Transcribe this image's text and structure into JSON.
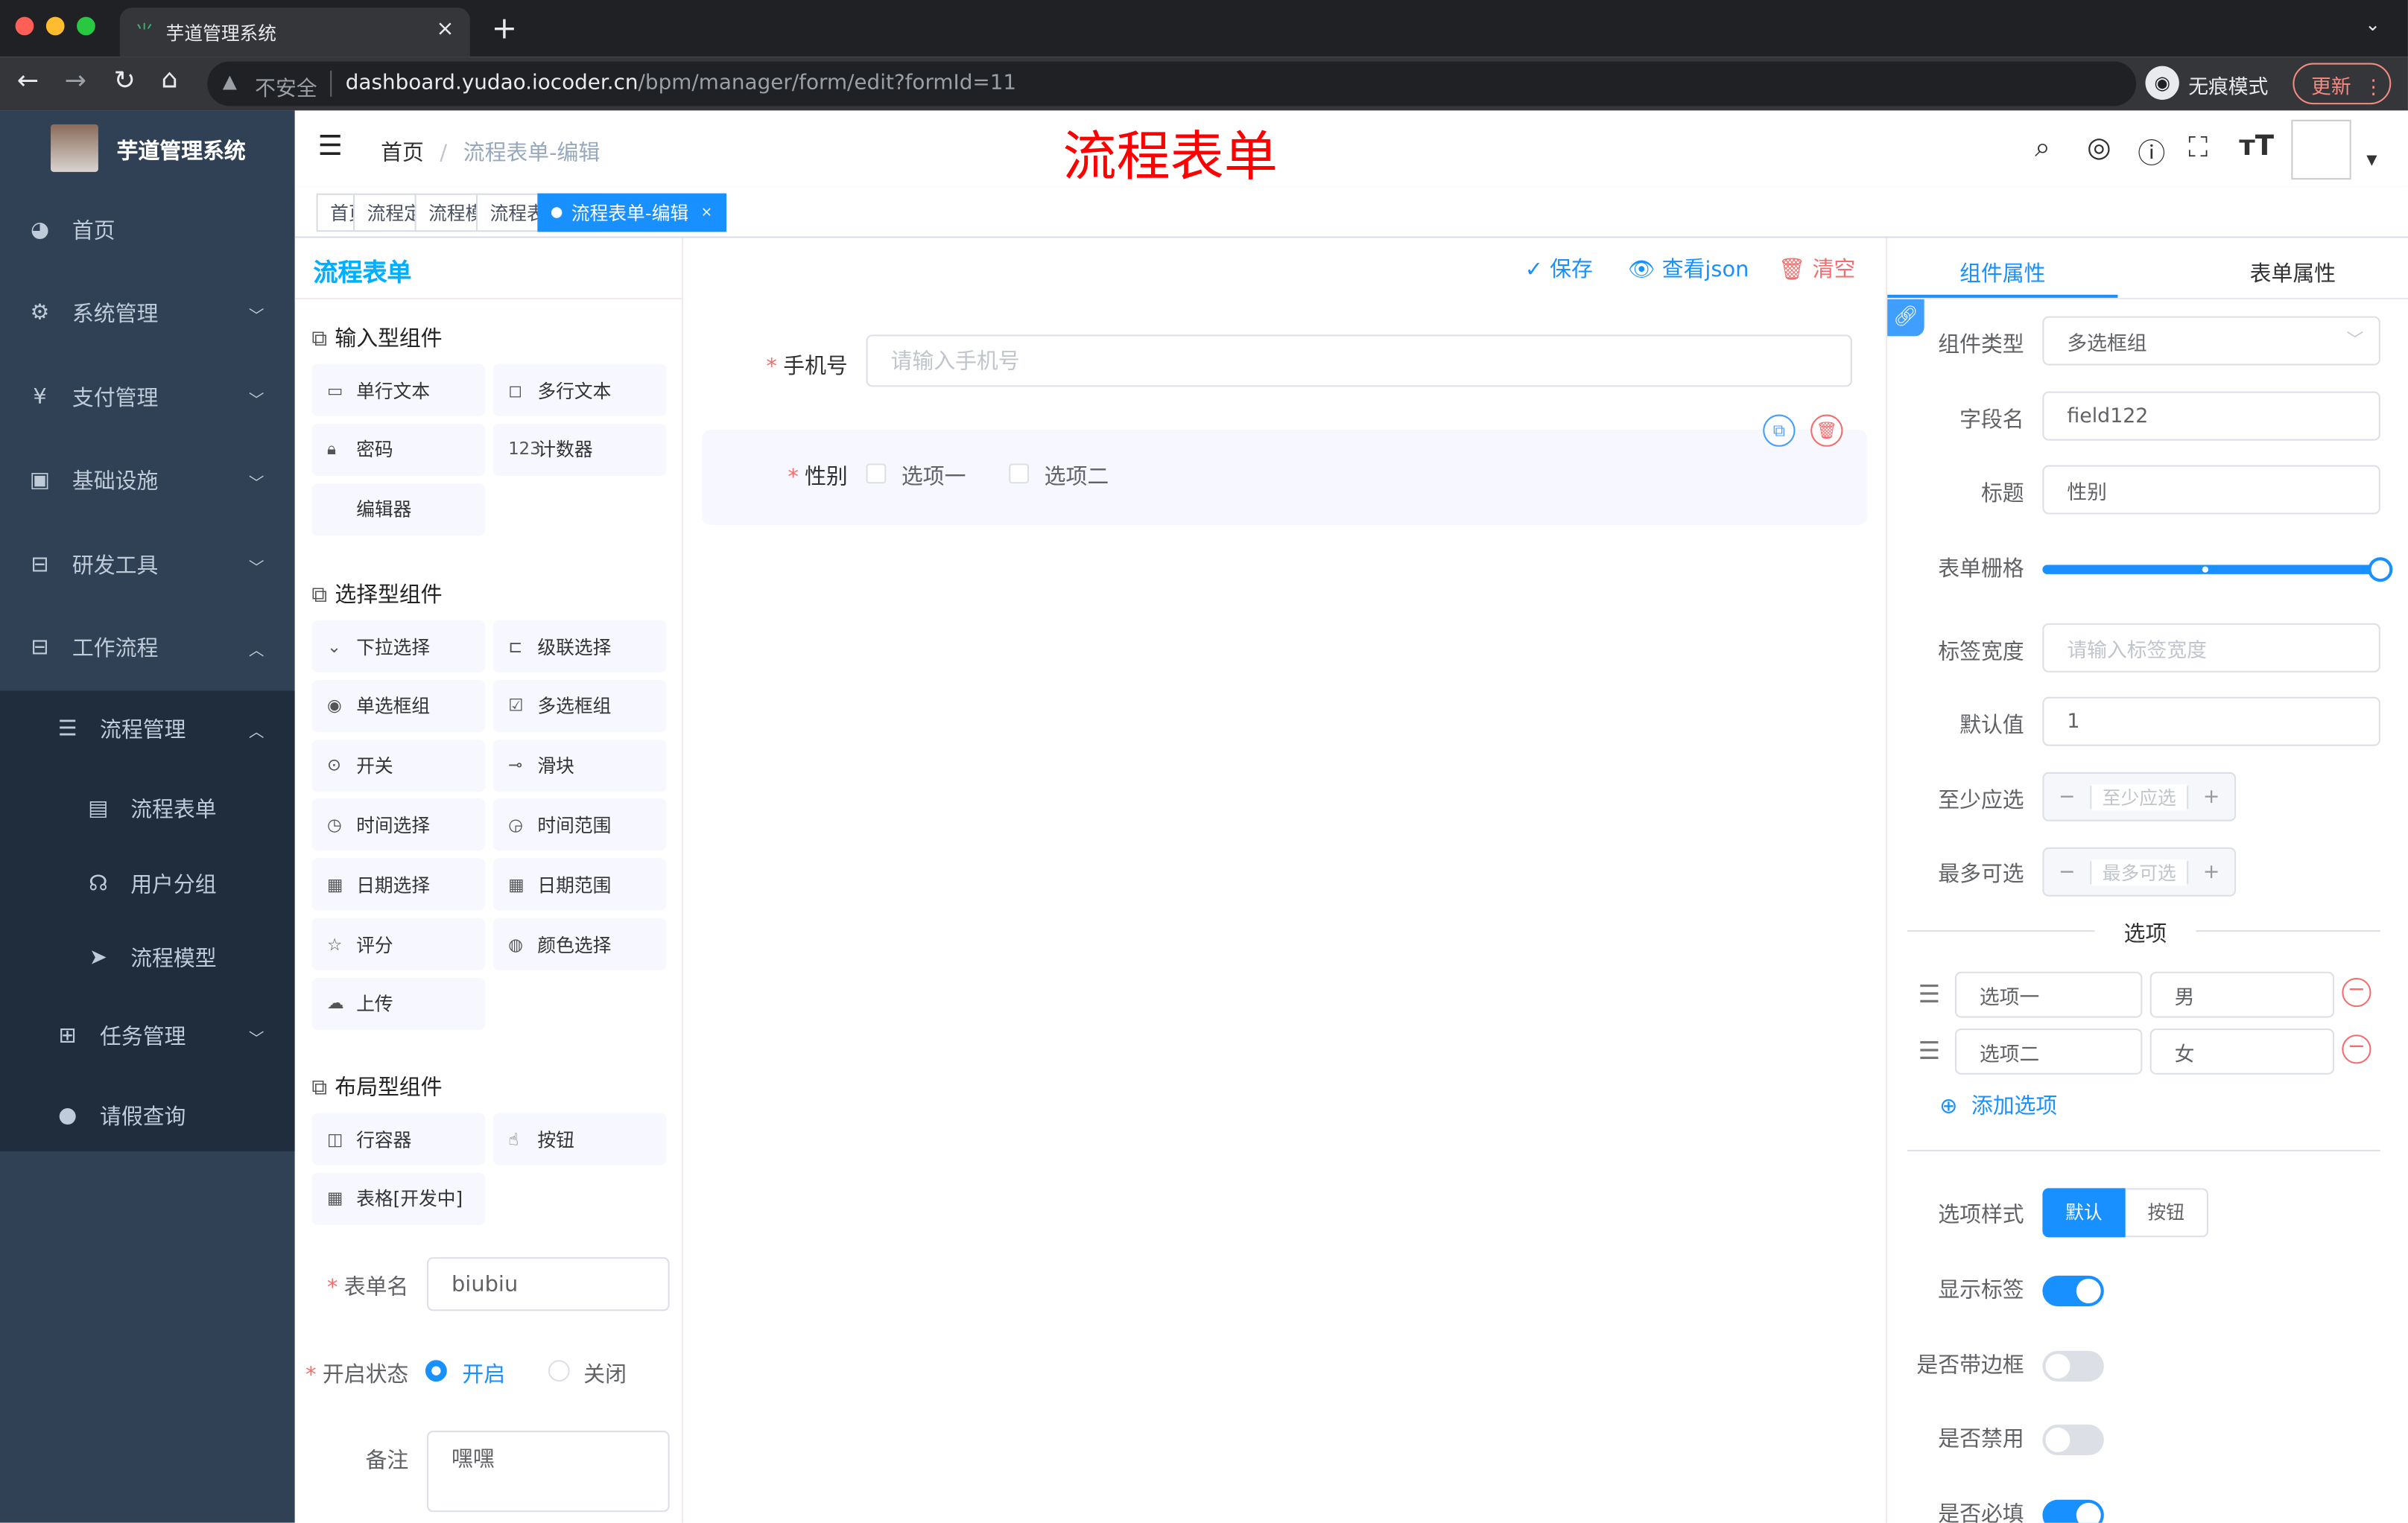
{
  "browser": {
    "tab_title": "芋道管理系统",
    "close": "×",
    "new_tab": "+",
    "insecure": "不安全",
    "url_host": "dashboard.yudao.iocoder.cn",
    "url_path": "/bpm/manager/form/edit?formId=11",
    "incognito": "无痕模式",
    "update": "更新"
  },
  "sidebar": {
    "app_name": "芋道管理系统",
    "items": [
      {
        "label": "首页",
        "icon": "dashboard-icon",
        "glyph": "◕",
        "chev": ""
      },
      {
        "label": "系统管理",
        "icon": "gear-icon",
        "glyph": "⚙",
        "chev": "﹀"
      },
      {
        "label": "支付管理",
        "icon": "yen-icon",
        "glyph": "¥",
        "chev": "﹀"
      },
      {
        "label": "基础设施",
        "icon": "monitor-icon",
        "glyph": "▣",
        "chev": "﹀"
      },
      {
        "label": "研发工具",
        "icon": "toolbox-icon",
        "glyph": "⊟",
        "chev": "﹀"
      },
      {
        "label": "工作流程",
        "icon": "briefcase-icon",
        "glyph": "⊟",
        "chev": "︿"
      }
    ],
    "sub_items": [
      {
        "label": "流程管理",
        "icon": "tree-icon",
        "glyph": "☰",
        "chev": "︿",
        "level": 1
      },
      {
        "label": "流程表单",
        "icon": "form-icon",
        "glyph": "▤",
        "chev": "",
        "level": 2
      },
      {
        "label": "用户分组",
        "icon": "group-icon",
        "glyph": "☊",
        "chev": "",
        "level": 2
      },
      {
        "label": "流程模型",
        "icon": "send-icon",
        "glyph": "➤",
        "chev": "",
        "level": 2
      },
      {
        "label": "任务管理",
        "icon": "tree-icon",
        "glyph": "⊞",
        "chev": "﹀",
        "level": 1
      },
      {
        "label": "请假查询",
        "icon": "user-icon",
        "glyph": "●",
        "chev": "",
        "level": 1
      }
    ]
  },
  "navbar": {
    "breadcrumb": [
      "首页",
      "流程表单-编辑"
    ],
    "separator": "/",
    "page_heading": "流程表单"
  },
  "tags": [
    {
      "label": "首页",
      "closable": false,
      "active": false
    },
    {
      "label": "流程定义",
      "closable": true,
      "active": false
    },
    {
      "label": "流程模型",
      "closable": true,
      "active": false
    },
    {
      "label": "流程表单",
      "closable": true,
      "active": false
    },
    {
      "label": "流程表单-编辑",
      "closable": true,
      "active": true
    }
  ],
  "left": {
    "title": "流程表单",
    "sections": [
      {
        "title": "输入型组件",
        "items": [
          {
            "label": "单行文本",
            "glyph": "▭",
            "icon": "input-icon"
          },
          {
            "label": "多行文本",
            "glyph": "◻",
            "icon": "textarea-icon"
          },
          {
            "label": "密码",
            "glyph": "🔒︎",
            "icon": "lock-icon"
          },
          {
            "label": "计数器",
            "glyph": "123",
            "icon": "number-icon"
          },
          {
            "label": "编辑器",
            "glyph": "",
            "icon": "editor-icon"
          }
        ]
      },
      {
        "title": "选择型组件",
        "items": [
          {
            "label": "下拉选择",
            "glyph": "⌄",
            "icon": "select-icon"
          },
          {
            "label": "级联选择",
            "glyph": "⊏",
            "icon": "cascader-icon"
          },
          {
            "label": "单选框组",
            "glyph": "◉",
            "icon": "radio-icon"
          },
          {
            "label": "多选框组",
            "glyph": "☑",
            "icon": "checkbox-icon"
          },
          {
            "label": "开关",
            "glyph": "⊙",
            "icon": "switch-icon"
          },
          {
            "label": "滑块",
            "glyph": "⊸",
            "icon": "slider-icon"
          },
          {
            "label": "时间选择",
            "glyph": "◷",
            "icon": "clock-icon"
          },
          {
            "label": "时间范围",
            "glyph": "◶",
            "icon": "time-range-icon"
          },
          {
            "label": "日期选择",
            "glyph": "▦",
            "icon": "calendar-icon"
          },
          {
            "label": "日期范围",
            "glyph": "▦",
            "icon": "date-range-icon"
          },
          {
            "label": "评分",
            "glyph": "☆",
            "icon": "star-icon"
          },
          {
            "label": "颜色选择",
            "glyph": "◍",
            "icon": "palette-icon"
          },
          {
            "label": "上传",
            "glyph": "☁",
            "icon": "upload-icon"
          }
        ]
      },
      {
        "title": "布局型组件",
        "items": [
          {
            "label": "行容器",
            "glyph": "◫",
            "icon": "row-icon"
          },
          {
            "label": "按钮",
            "glyph": "☝",
            "icon": "button-icon"
          },
          {
            "label": "表格[开发中]",
            "glyph": "▦",
            "icon": "table-icon"
          }
        ]
      }
    ],
    "form": {
      "name_label": "表单名",
      "name_value": "biubiu",
      "status_label": "开启状态",
      "status_on": "开启",
      "status_off": "关闭",
      "status_selected": "开启",
      "remark_label": "备注",
      "remark_value": "嘿嘿"
    }
  },
  "toolbar": {
    "save": "保存",
    "view_json": "查看json",
    "clear": "清空"
  },
  "canvas": {
    "phone_label": "手机号",
    "phone_placeholder": "请输入手机号",
    "gender_label": "性别",
    "options": [
      "选项一",
      "选项二"
    ]
  },
  "right": {
    "tabs": [
      "组件属性",
      "表单属性"
    ],
    "active_tab": "组件属性",
    "fields": {
      "type_label": "组件类型",
      "type_value": "多选框组",
      "field_label": "字段名",
      "field_value": "field122",
      "title_label": "标题",
      "title_value": "性别",
      "grid_label": "表单栅格",
      "grid_value": 24,
      "grid_max": 24,
      "label_width_label": "标签宽度",
      "label_width_placeholder": "请输入标签宽度",
      "default_label": "默认值",
      "default_value": "1",
      "min_label": "至少应选",
      "min_placeholder": "至少应选",
      "max_label": "最多可选",
      "max_placeholder": "最多可选"
    },
    "options_title": "选项",
    "options": [
      {
        "label": "选项一",
        "value": "男"
      },
      {
        "label": "选项二",
        "value": "女"
      }
    ],
    "add_option": "添加选项",
    "style_label": "选项样式",
    "style_options": [
      "默认",
      "按钮"
    ],
    "style_selected": "默认",
    "switches": [
      {
        "label": "显示标签",
        "on": true
      },
      {
        "label": "是否带边框",
        "on": false
      },
      {
        "label": "是否禁用",
        "on": false
      },
      {
        "label": "是否必填",
        "on": true
      }
    ]
  },
  "colors": {
    "primary": "#1890ff",
    "danger": "#f56c6c",
    "sidebar": "#304156",
    "heading": "#ff0000"
  }
}
